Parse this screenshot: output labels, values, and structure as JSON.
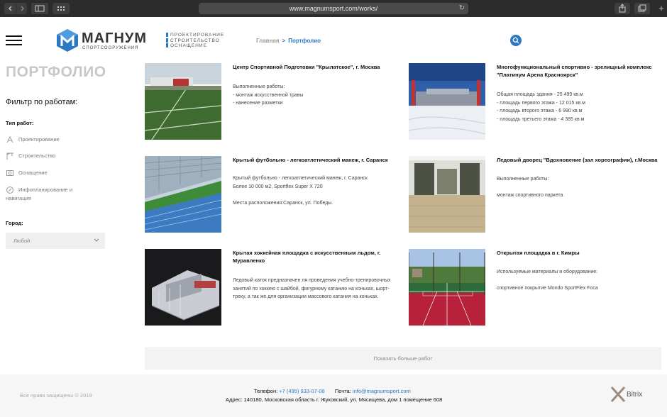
{
  "browser": {
    "url": "www.magnumsport.com/works/"
  },
  "header": {
    "brand": "МАГНУМ",
    "brand_sub": "СПОРТСООРУЖЕНИЯ",
    "tagline": [
      "ПРОЕКТИРОВАНИЕ",
      "СТРОИТЕЛЬСТВО",
      "ОСНАЩЕНИЕ"
    ],
    "breadcrumb": {
      "home": "Главная",
      "separator": ">",
      "current": "Портфолио"
    }
  },
  "sidebar": {
    "page_title": "ПОРТФОЛИО",
    "filter_title": "Фильтр по работам:",
    "type_title": "Тип работ:",
    "types": [
      {
        "label": "Проектирование",
        "icon": "drafting-icon"
      },
      {
        "label": "Строительство",
        "icon": "crane-icon"
      },
      {
        "label": "Оснащение",
        "icon": "equipment-icon"
      },
      {
        "label": "Инфопланирование и навигация",
        "icon": "navigation-icon"
      }
    ],
    "city_title": "Город:",
    "city_value": "Любой"
  },
  "works": [
    {
      "title": "Центр Спортивной Подготовки \"Крылатское\", г. Москва",
      "body": "Выполненные работы:\n- монтаж искусственной травы\n- нанесение разметки"
    },
    {
      "title": "Многофункциональный спортивно - зрелищный комплекс \"Платинум Арена Красноярск\"",
      "body": "Общая площадь здания - 25 499 кв.м\n- площадь первого этажа - 12 015 кв.м\n- площадь второго этажа - 6 990 кв.м\n- площадь третьего этажа - 4 385 кв.м"
    },
    {
      "title": "Крытый футбольно - легкоатлетический манеж, г. Саранск",
      "body": "Крытый футбольно - легкоатлетический манеж, г. Саранск\nБолее 10 000 м2, Sportflex Super X 720\n\nМеста расположения:Саранск, ул. Победы."
    },
    {
      "title": "Ледовый дворец \"Вдохновение (зал хореографии), г.Москва",
      "body": "Выполненные работы:\n\nмонтаж спортивного паркета"
    },
    {
      "title": "Крытая хоккейная площадка с искусственным льдом, г. Муравленко",
      "body": "Ледовый каток предназначен ля проведения учебно-тренировочных занятий по хоккею с шайбой, фигурному катанию на коньках, шорт-треку, а так же для организации массового катания на коньках."
    },
    {
      "title": "Открытая площадка в г. Кимры",
      "body": "Используемые материалы и оборудование:\n\nспортивное покрытие Mondo SportFlex Foca"
    }
  ],
  "more_button": "Показать больше работ",
  "footer": {
    "copyright": "Все права защищены © 2019",
    "phone_label": "Телефон:",
    "phone": "+7 (495) 933-07-06",
    "mail_label": "Почта:",
    "email": "info@magnumsport.com",
    "address": "Адрес: 140180, Московская область г. Жуковский, ул. Мясищева, дом 1 помещение 608",
    "bitrix": "Bitrix"
  },
  "colors": {
    "accent": "#2b79c2",
    "title_gray": "#c8c8c8"
  }
}
